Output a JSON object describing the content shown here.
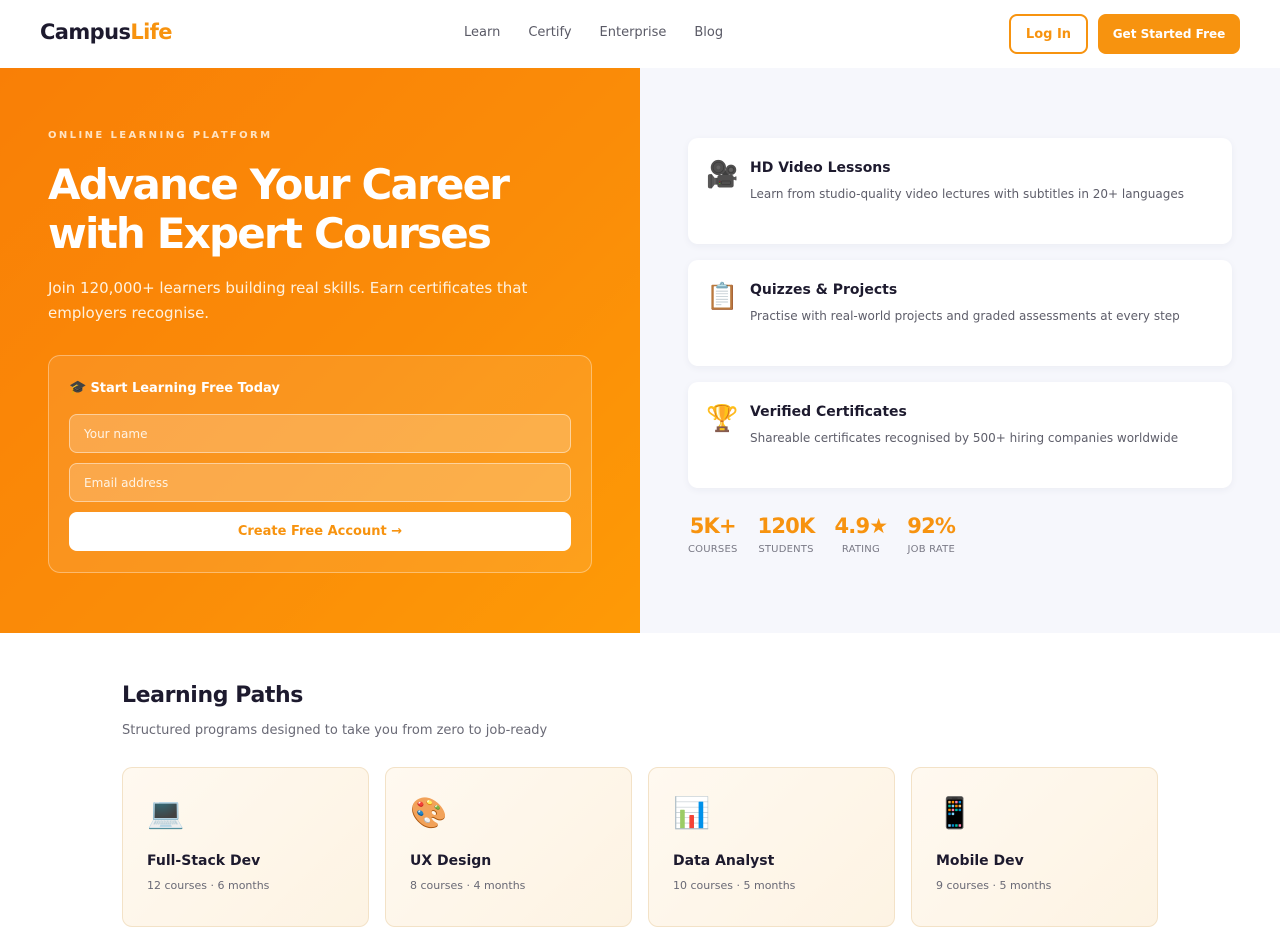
{
  "brand": {
    "logo_part1": "Campus",
    "logo_part2": "Life",
    "accent_color": "#f7930f"
  },
  "nav": {
    "links": [
      "Learn",
      "Certify",
      "Enterprise",
      "Blog"
    ],
    "login_label": "Log In",
    "cta_label": "Get Started Free"
  },
  "hero": {
    "eyebrow": "ONLINE LEARNING PLATFORM",
    "headline_line1": "Advance Your Career",
    "headline_line2": "with Expert Courses",
    "lead": "Join 120,000+ learners building real skills. Earn certificates that employers recognise.",
    "signup": {
      "icon": "graduation-cap-icon",
      "title": "Start Learning Free Today",
      "name_placeholder": "Your name",
      "email_placeholder": "Email address",
      "submit_label": "Create Free Account →"
    }
  },
  "features": [
    {
      "icon": "video-camera-icon",
      "title": "HD Video Lessons",
      "description": "Learn from studio-quality video lectures with subtitles in 20+ languages"
    },
    {
      "icon": "clipboard-icon",
      "title": "Quizzes & Projects",
      "description": "Practise with real-world projects and graded assessments at every step"
    },
    {
      "icon": "trophy-icon",
      "title": "Verified Certificates",
      "description": "Shareable certificates recognised by 500+ hiring companies worldwide"
    }
  ],
  "stats": [
    {
      "value": "5K+",
      "label": "COURSES"
    },
    {
      "value": "120K",
      "label": "STUDENTS"
    },
    {
      "value": "4.9★",
      "label": "RATING"
    },
    {
      "value": "92%",
      "label": "JOB RATE"
    }
  ],
  "paths": {
    "title": "Learning Paths",
    "subtitle": "Structured programs designed to take you from zero to job-ready",
    "items": [
      {
        "icon": "laptop-icon",
        "title": "Full-Stack Dev",
        "meta": "12 courses · 6 months"
      },
      {
        "icon": "palette-icon",
        "title": "UX Design",
        "meta": "8 courses · 4 months"
      },
      {
        "icon": "bar-chart-icon",
        "title": "Data Analyst",
        "meta": "10 courses · 5 months"
      },
      {
        "icon": "mobile-phone-icon",
        "title": "Mobile Dev",
        "meta": "9 courses · 5 months"
      }
    ]
  }
}
